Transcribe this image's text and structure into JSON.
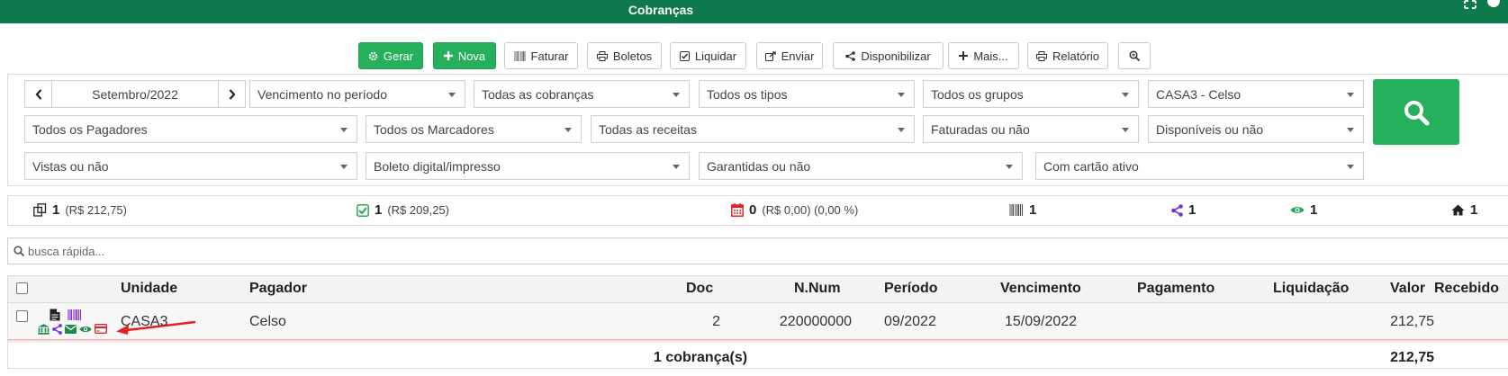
{
  "window": {
    "title": "Cobranças"
  },
  "toolbar": {
    "gerar": "Gerar",
    "nova": "Nova",
    "faturar": "Faturar",
    "boletos": "Boletos",
    "liquidar": "Liquidar",
    "enviar": "Enviar",
    "disponibilizar": "Disponibilizar",
    "mais": "Mais...",
    "relatorio": "Relatório"
  },
  "filters": {
    "period": "Setembro/2022",
    "vencimento": "Vencimento no período",
    "cobrancas": "Todas as cobranças",
    "tipos": "Todos os tipos",
    "grupos": "Todos os grupos",
    "casa": "CASA3 - Celso",
    "pagadores": "Todos os Pagadores",
    "marcadores": "Todos os Marcadores",
    "receitas": "Todas as receitas",
    "faturadas": "Faturadas ou não",
    "disponiveis": "Disponíveis ou não",
    "vistas": "Vistas ou não",
    "boleto": "Boleto digital/impresso",
    "garantidas": "Garantidas ou não",
    "cartao": "Com cartão ativo"
  },
  "summary": {
    "total_count": "1",
    "total_value": "(R$ 212,75)",
    "paid_count": "1",
    "paid_value": "(R$ 209,25)",
    "late_count": "0",
    "late_value": "(R$ 0,00) (0,00 %)",
    "boleto_count": "1",
    "shared_count": "1",
    "viewed_count": "1",
    "home_count": "1"
  },
  "search": {
    "placeholder": "busca rápida..."
  },
  "table": {
    "headers": {
      "unidade": "Unidade",
      "pagador": "Pagador",
      "doc": "Doc",
      "nnum": "N.Num",
      "periodo": "Período",
      "vencimento": "Vencimento",
      "pagamento": "Pagamento",
      "liquidacao": "Liquidação",
      "valor": "Valor",
      "recebido": "Recebido"
    },
    "rows": [
      {
        "unidade": "CASA3",
        "pagador": "Celso",
        "doc": "2",
        "nnum": "220000000",
        "periodo": "09/2022",
        "vencimento": "15/09/2022",
        "pagamento": "",
        "liquidacao": "",
        "valor": "212,75",
        "recebido": ""
      }
    ],
    "footer": {
      "count": "1 cobrança(s)",
      "total": "212,75"
    }
  },
  "colors": {
    "header_green": "#0e7a4b",
    "button_green": "#27b05c",
    "purple": "#7a2fd6",
    "red": "#e0242b",
    "annotation_red": "#e82020"
  }
}
